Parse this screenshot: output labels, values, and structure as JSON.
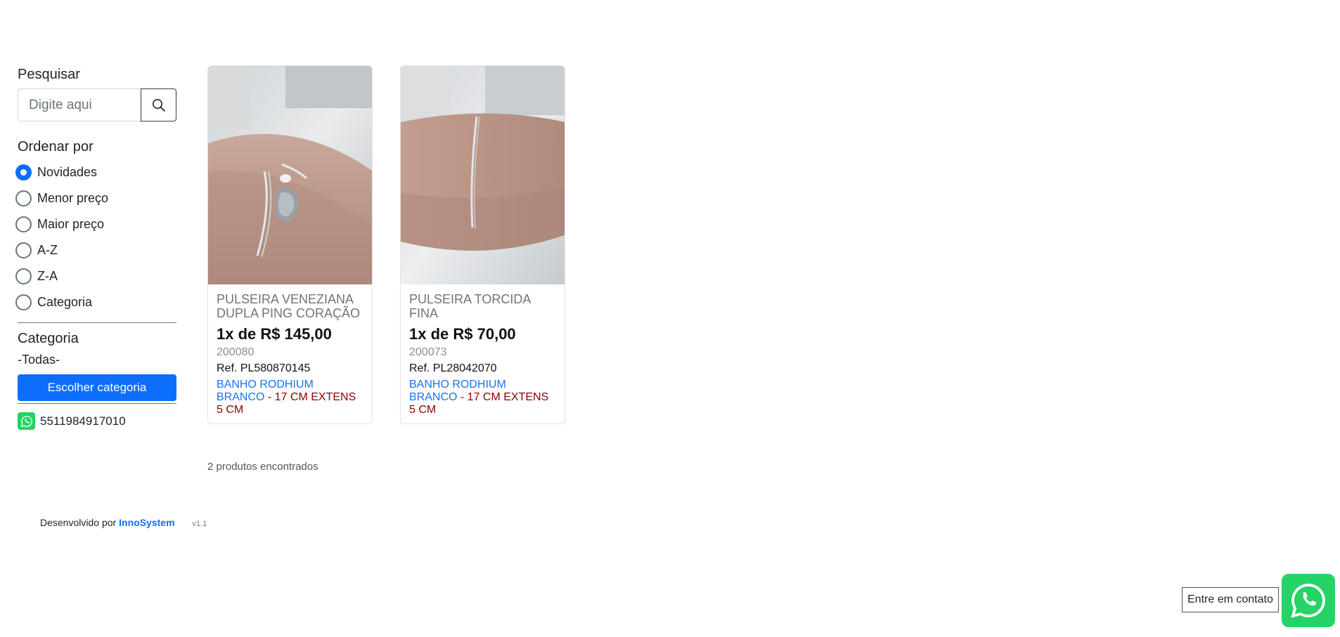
{
  "sidebar": {
    "search_title": "Pesquisar",
    "search_placeholder": "Digite aqui",
    "order_title": "Ordenar por",
    "order_options": [
      {
        "label": "Novidades",
        "checked": true
      },
      {
        "label": "Menor preço",
        "checked": false
      },
      {
        "label": "Maior preço",
        "checked": false
      },
      {
        "label": "A-Z",
        "checked": false
      },
      {
        "label": "Z-A",
        "checked": false
      },
      {
        "label": "Categoria",
        "checked": false
      }
    ],
    "category_title": "Categoria",
    "category_value": "-Todas-",
    "category_button": "Escolher categoria",
    "phone": "5511984917010"
  },
  "products": [
    {
      "name": "PULSEIRA VENEZIANA DUPLA PING CORAÇÃO",
      "price": "1x de R$ 145,00",
      "code": "200080",
      "ref": "Ref. PL580870145",
      "tag_blue": "BANHO RODHIUM BRANCO",
      "tag_red": " - 17 CM EXTENS 5 CM"
    },
    {
      "name": "PULSEIRA TORCIDA FINA",
      "price": "1x de R$ 70,00",
      "code": "200073",
      "ref": "Ref. PL28042070",
      "tag_blue": "BANHO RODHIUM BRANCO",
      "tag_red": " - 17 CM EXTENS 5 CM"
    }
  ],
  "results": "2 produtos encontrados",
  "footer": {
    "developed_by": "Desenvolvido por",
    "brand": "InnoSystem",
    "version": "v1.1"
  },
  "contact_button": "Entre em contato",
  "colors": {
    "primary": "#0d6efd",
    "whatsapp": "#25d366",
    "tag_blue": "#1a73e8",
    "tag_red": "#8b0000"
  }
}
